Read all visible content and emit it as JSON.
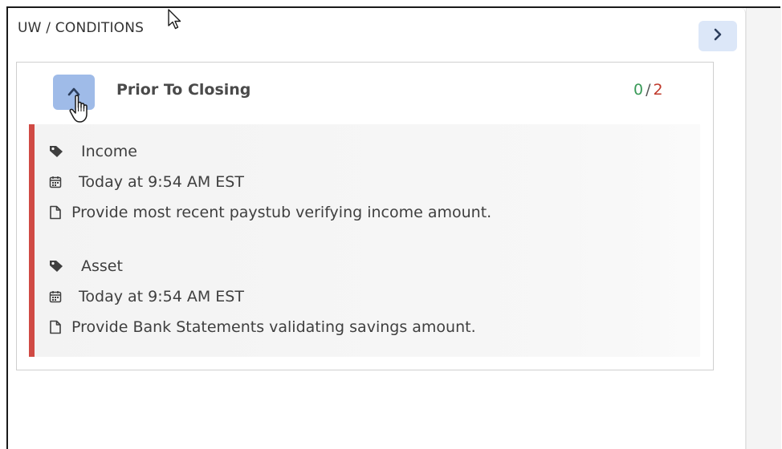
{
  "panel": {
    "title": "UW / CONDITIONS"
  },
  "group": {
    "title": "Prior To Closing",
    "completed": "0",
    "separator": "/",
    "total": "2"
  },
  "conditions": [
    {
      "category": "Income",
      "date": "Today at 9:54 AM EST",
      "description": "Provide most recent paystub verifying income amount."
    },
    {
      "category": "Asset",
      "date": "Today at 9:54 AM EST",
      "description": "Provide Bank Statements validating savings amount."
    }
  ],
  "icons": {
    "expand": "chevron-right-icon",
    "collapse": "chevron-up-icon",
    "category": "tag-icon",
    "date": "calendar-icon",
    "description": "document-icon"
  },
  "colors": {
    "accent_button": "#dce7f8",
    "active_button": "#9fbbe8",
    "completed": "#3a9a58",
    "total": "#c0392b",
    "priority_bar": "#d04a44"
  }
}
